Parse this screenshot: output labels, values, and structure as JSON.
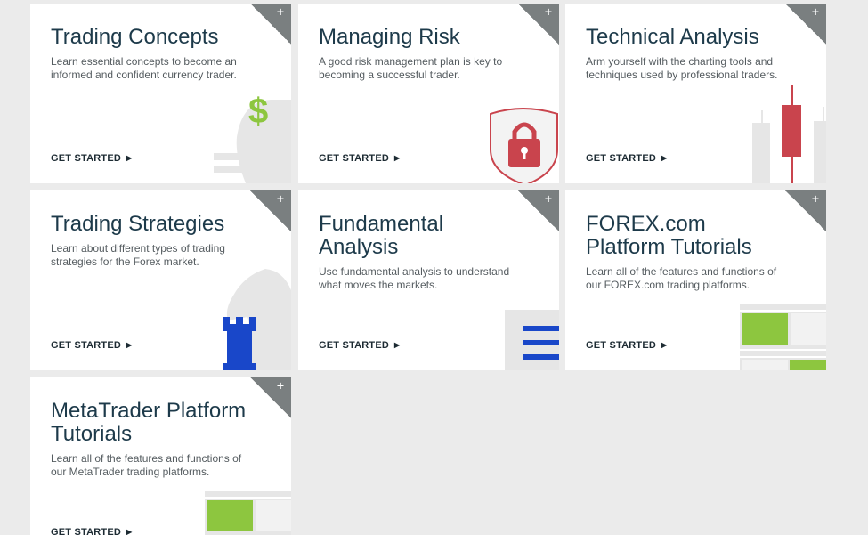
{
  "cards": [
    {
      "title": "Trading Concepts",
      "description": "Learn essential concepts to become an informed and confident currency trader.",
      "cta": "GET STARTED",
      "arrow": "▶",
      "expand": "+",
      "icon": "dollar-sign"
    },
    {
      "title": "Managing Risk",
      "description": "A good risk management plan is key to becoming a successful trader.",
      "cta": "GET STARTED",
      "arrow": "▶",
      "expand": "+",
      "icon": "shield-lock"
    },
    {
      "title": "Technical Analysis",
      "description": "Arm yourself with the charting tools and techniques used by professional traders.",
      "cta": "GET STARTED",
      "arrow": "▶",
      "expand": "+",
      "icon": "candlestick"
    },
    {
      "title": "Trading Strategies",
      "description": "Learn about different types of trading strategies for the Forex market.",
      "cta": "GET STARTED",
      "arrow": "▶",
      "expand": "+",
      "icon": "chess-pieces"
    },
    {
      "title": "Fundamental\nAnalysis",
      "description": "Use fundamental analysis to understand what moves the markets.",
      "cta": "GET STARTED",
      "arrow": "▶",
      "expand": "+",
      "icon": "document-lines"
    },
    {
      "title": "FOREX.com\nPlatform Tutorials",
      "description": "Learn all of the features and functions of our FOREX.com trading platforms.",
      "cta": "GET STARTED",
      "arrow": "▶",
      "expand": "+",
      "icon": "platform-window"
    },
    {
      "title": "MetaTrader Platform\nTutorials",
      "description": "Learn all of the features and functions of our MetaTrader trading platforms.",
      "cta": "GET STARTED",
      "arrow": "▶",
      "expand": "+",
      "icon": "platform-window"
    }
  ],
  "colors": {
    "title": "#1d3a4a",
    "corner": "#7a7f80",
    "green": "#8dc63f",
    "red": "#c9444d",
    "blue": "#1947c9",
    "illustration_gray": "#e6e6e6"
  }
}
